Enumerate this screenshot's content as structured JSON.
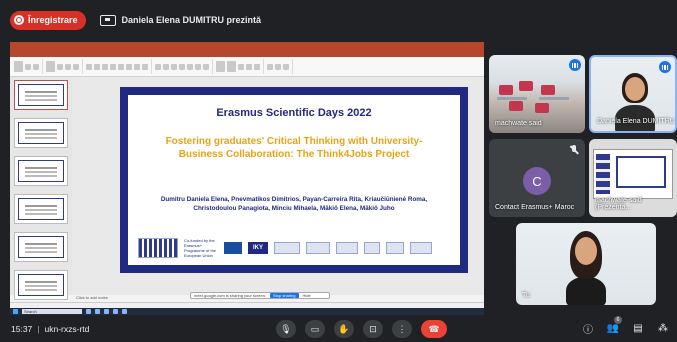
{
  "top": {
    "recording_label": "Înregistrare",
    "presenter_text": "Daniela Elena DUMITRU prezintă"
  },
  "share": {
    "notes_placeholder": "Click to add notes",
    "sharing_banner": "meet.google.com is sharing your screen.",
    "stop_sharing": "Stop sharing",
    "hide": "Hide",
    "taskbar_search": "Search",
    "slide": {
      "title": "Erasmus Scientific Days 2022",
      "subtitle": "Fostering graduates' Critical Thinking with University-Business Collaboration: The Think4Jobs Project",
      "authors": "Dumitru Daniela Elena, Pnevmatikos Dimitrios, Payan-Carreira Rita, Kriaučiūnienė Roma, Christodoulou Panagiota, Minciu Mihaela, Mäkiö Elena, Mäkiö Juho",
      "cofunded": "Co-funded by the Erasmus+ Programme of the European Union",
      "iky": "IKY"
    }
  },
  "participants": [
    {
      "name": "machwate said",
      "state": "speaking"
    },
    {
      "name": "Daniela Elena DUMITRU",
      "state": "speaking"
    },
    {
      "name": "Contact Erasmus+ Maroc",
      "state": "muted",
      "initial": "C"
    },
    {
      "name": "machwate said (Prezenta...",
      "state": "presenting"
    },
    {
      "name": "Tu",
      "state": "self"
    }
  ],
  "bottom": {
    "time": "15:37",
    "meeting_code": "ukn-rxzs-rtd",
    "participant_count": "6"
  },
  "colors": {
    "background": "#202124",
    "record": "#d93025",
    "end_call": "#ea4335",
    "slide_frame": "#1f2a80",
    "slide_subtitle": "#e8a317"
  }
}
